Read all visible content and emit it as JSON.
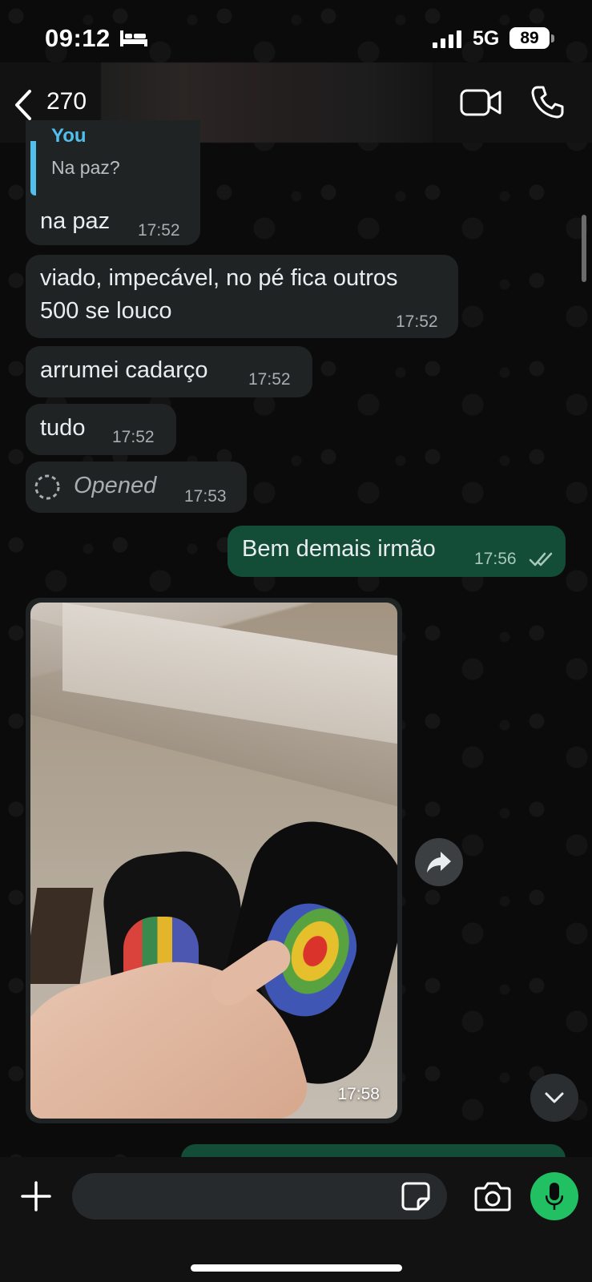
{
  "status_bar": {
    "time": "09:12",
    "network": "5G",
    "battery": "89",
    "icons": [
      "bed-icon",
      "signal-icon"
    ]
  },
  "header": {
    "unread_count": "270",
    "contact_name": "",
    "icons": [
      "back-icon",
      "video-call-icon",
      "voice-call-icon"
    ]
  },
  "messages": [
    {
      "direction": "incoming",
      "quote": {
        "author": "You",
        "text": "Na paz?"
      },
      "text": "na paz",
      "time": "17:52"
    },
    {
      "direction": "incoming",
      "lines": [
        "viado, impecável, no pé fica outros",
        "500 se louco"
      ],
      "time": "17:52"
    },
    {
      "direction": "incoming",
      "text": "arrumei cadarço",
      "time": "17:52"
    },
    {
      "direction": "incoming",
      "text": "tudo",
      "time": "17:52"
    },
    {
      "direction": "incoming",
      "type": "view-once",
      "text": "Opened",
      "time": "17:53"
    },
    {
      "direction": "outgoing",
      "text": "Bem demais irmão",
      "time": "17:56",
      "status": "read"
    },
    {
      "direction": "incoming",
      "type": "image",
      "description_icon": "photo",
      "time": "17:58"
    }
  ],
  "composer": {
    "placeholder": "",
    "icons": [
      "plus-icon",
      "sticker-icon",
      "camera-icon",
      "mic-icon"
    ]
  },
  "colors": {
    "incoming_bubble": "#1f2324",
    "outgoing_bubble": "#134d37",
    "quote_accent": "#53bdeb",
    "mic_button": "#21c063"
  }
}
